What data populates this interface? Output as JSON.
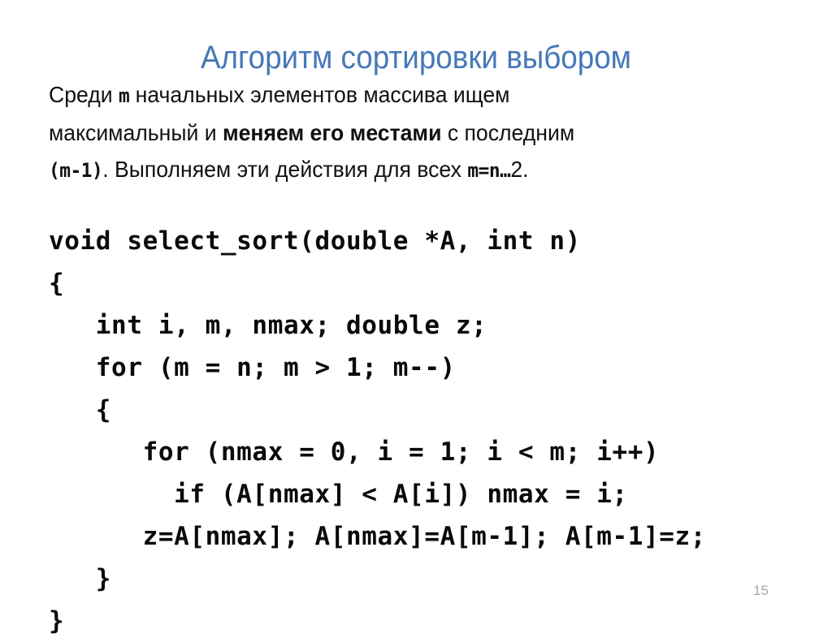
{
  "slide": {
    "title": "Алгоритм сортировки выбором",
    "title_color": "#4578b8",
    "background_color": "#ffffff",
    "page_number": "15"
  },
  "paragraph": {
    "line1": {
      "part1": "Среди ",
      "code1": "m",
      "part2": " начальных элементов массива ищем"
    },
    "line2": {
      "part1": "максимальный и ",
      "bold": "меняем его местами",
      "part2": " с последним"
    },
    "line3": {
      "code1": "(m-1)",
      "part1": ". Выполняем эти действия для всех ",
      "code2": "m=n…",
      "part2": "2."
    }
  },
  "code": {
    "language": "c",
    "text_color": "#0a0a0a",
    "lines": [
      "void select_sort(double *A, int n)",
      "{",
      "   int i, m, nmax; double z;",
      "   for (m = n; m > 1; m--)",
      "   {",
      "      for (nmax = 0, i = 1; i < m; i++)",
      "        if (A[nmax] < A[i]) nmax = i;",
      "      z=A[nmax]; A[nmax]=A[m-1]; A[m-1]=z;",
      "   }",
      "}"
    ]
  }
}
